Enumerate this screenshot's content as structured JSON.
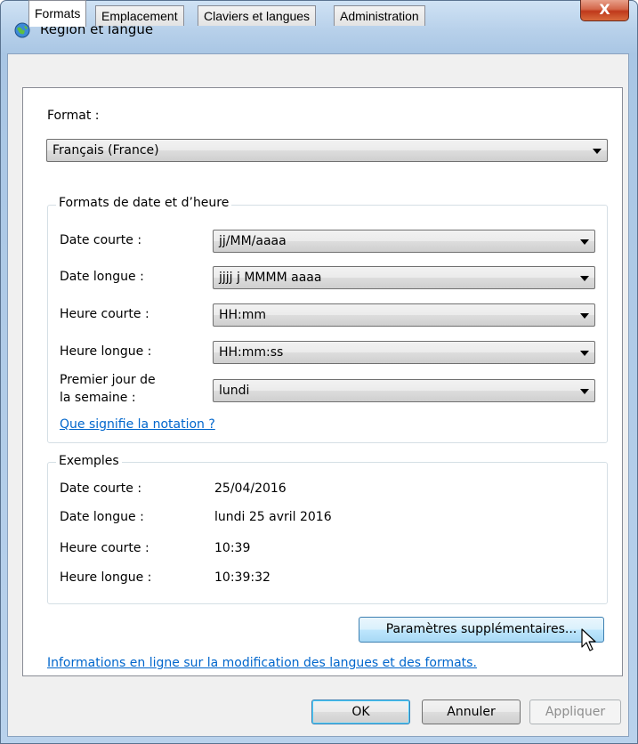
{
  "window": {
    "title": "Région et langue",
    "close_label": "X"
  },
  "tabs": [
    {
      "label": "Formats"
    },
    {
      "label": "Emplacement"
    },
    {
      "label": "Claviers et langues"
    },
    {
      "label": "Administration"
    }
  ],
  "format": {
    "label": "Format :",
    "value": "Français (France)"
  },
  "date_time_group": {
    "legend": "Formats de date et d’heure",
    "rows": [
      {
        "label": "Date courte :",
        "value": "jj/MM/aaaa"
      },
      {
        "label": "Date longue :",
        "value": "jjjj j MMMM aaaa"
      },
      {
        "label": "Heure courte :",
        "value": "HH:mm"
      },
      {
        "label": "Heure longue :",
        "value": "HH:mm:ss"
      },
      {
        "label_line1": "Premier jour de",
        "label_line2": "la semaine :",
        "value": "lundi"
      }
    ],
    "notation_link": "Que signifie la notation ?"
  },
  "examples_group": {
    "legend": "Exemples",
    "rows": [
      {
        "label": "Date courte :",
        "value": "25/04/2016"
      },
      {
        "label": "Date longue :",
        "value": "lundi 25 avril 2016"
      },
      {
        "label": "Heure courte :",
        "value": "10:39"
      },
      {
        "label": "Heure longue :",
        "value": "10:39:32"
      }
    ]
  },
  "additional_settings_button": "Paramètres supplémentaires...",
  "info_link": "Informations en ligne sur la modification des langues et des formats.",
  "buttons": {
    "ok": "OK",
    "cancel": "Annuler",
    "apply": "Appliquer"
  }
}
